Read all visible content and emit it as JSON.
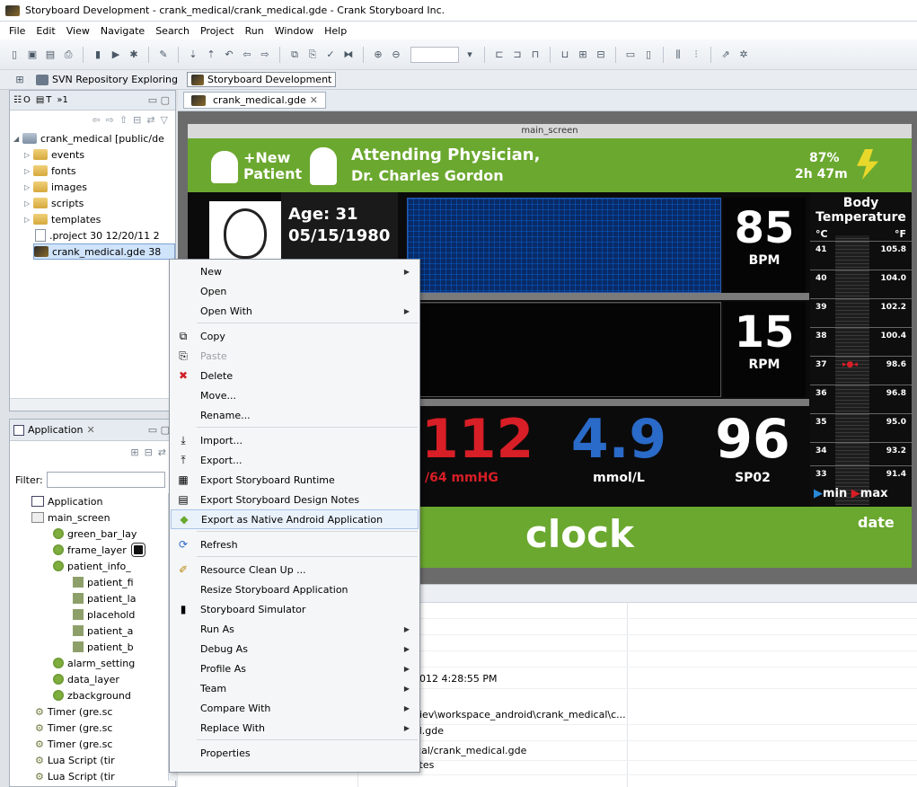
{
  "window": {
    "title": "Storyboard Development - crank_medical/crank_medical.gde - Crank Storyboard Inc."
  },
  "menubar": [
    "File",
    "Edit",
    "View",
    "Navigate",
    "Search",
    "Project",
    "Run",
    "Window",
    "Help"
  ],
  "perspectives": {
    "svn": "SVN Repository Exploring",
    "storyboard": "Storyboard Development"
  },
  "left_panel": {
    "tabs": [
      "O",
      "T",
      "»1"
    ],
    "tree": {
      "root": "crank_medical [public/de",
      "folders": [
        "events",
        "fonts",
        "images",
        "scripts",
        "templates"
      ],
      "project_file": ".project 30  12/20/11 2",
      "gde_file": "crank_medical.gde 38"
    }
  },
  "app_panel": {
    "tab": "Application",
    "filter_label": "Filter:",
    "items": [
      "Application",
      "main_screen",
      "green_bar_lay",
      "frame_layer",
      "patient_info_",
      "patient_fi",
      "patient_la",
      "placehold",
      "patient_a",
      "patient_b",
      "alarm_setting",
      "data_layer",
      "zbackground",
      "Timer (gre.sc",
      "Timer (gre.sc",
      "Timer (gre.sc",
      "Lua Script (tir",
      "Lua Script (tir"
    ]
  },
  "editor": {
    "tab": "crank_medical.gde",
    "screen_title": "main_screen",
    "new_patient_1": "+New",
    "new_patient_2": "Patient",
    "physician_1": "Attending Physician,",
    "physician_2": "Dr. Charles Gordon",
    "battery": "87%",
    "time_left": "2h 47m",
    "age": "Age: 31",
    "dob": "05/15/1980",
    "bpm_value": "85",
    "bpm_label": "BPM",
    "rpm_value": "15",
    "rpm_label": "RPM",
    "bp_value": "112",
    "bp_label": "/64 mmHG",
    "glucose_value": "4.9",
    "glucose_label": "mmol/L",
    "spo2_value": "96",
    "spo2_label": "SP02",
    "temp_title_1": "Body",
    "temp_title_2": "Temperature",
    "c_label": "°C",
    "f_label": "°F",
    "therm_rows": [
      [
        "41",
        "105.8"
      ],
      [
        "40",
        "104.0"
      ],
      [
        "39",
        "102.2"
      ],
      [
        "38",
        "100.4"
      ],
      [
        "37",
        "98.6"
      ],
      [
        "36",
        "96.8"
      ],
      [
        "35",
        "95.0"
      ],
      [
        "34",
        "93.2"
      ],
      [
        "33",
        "91.4"
      ]
    ],
    "min_label": "min",
    "max_label": "max",
    "clock": "clock",
    "date": "date"
  },
  "properties": {
    "values": [
      "2012 4:28:55 PM",
      "niev\\workspace_android\\crank_medical\\c...",
      "al.gde",
      "ical/crank_medical.gde",
      "ytes"
    ]
  },
  "context_menu": [
    {
      "label": "New",
      "sub": true,
      "icon": ""
    },
    {
      "label": "Open",
      "sub": false,
      "icon": ""
    },
    {
      "label": "Open With",
      "sub": true,
      "icon": ""
    },
    {
      "sep": true
    },
    {
      "label": "Copy",
      "sub": false,
      "icon": "copy"
    },
    {
      "label": "Paste",
      "sub": false,
      "icon": "paste",
      "disabled": true
    },
    {
      "label": "Delete",
      "sub": false,
      "icon": "delete"
    },
    {
      "label": "Move...",
      "sub": false,
      "icon": ""
    },
    {
      "label": "Rename...",
      "sub": false,
      "icon": ""
    },
    {
      "sep": true
    },
    {
      "label": "Import...",
      "sub": false,
      "icon": "import"
    },
    {
      "label": "Export...",
      "sub": false,
      "icon": "export"
    },
    {
      "label": "Export Storyboard Runtime",
      "sub": false,
      "icon": "runtime"
    },
    {
      "label": "Export Storyboard Design Notes",
      "sub": false,
      "icon": "notes"
    },
    {
      "label": "Export as Native Android Application",
      "sub": false,
      "icon": "android",
      "highlight": true
    },
    {
      "sep": true
    },
    {
      "label": "Refresh",
      "sub": false,
      "icon": "refresh"
    },
    {
      "sep": true
    },
    {
      "label": "Resource Clean Up ...",
      "sub": false,
      "icon": "clean"
    },
    {
      "label": "Resize Storyboard Application",
      "sub": false,
      "icon": ""
    },
    {
      "label": "Storyboard Simulator",
      "sub": false,
      "icon": "simulator"
    },
    {
      "label": "Run As",
      "sub": true,
      "icon": ""
    },
    {
      "label": "Debug As",
      "sub": true,
      "icon": ""
    },
    {
      "label": "Profile As",
      "sub": true,
      "icon": ""
    },
    {
      "label": "Team",
      "sub": true,
      "icon": ""
    },
    {
      "label": "Compare With",
      "sub": true,
      "icon": ""
    },
    {
      "label": "Replace With",
      "sub": true,
      "icon": ""
    },
    {
      "sep": true
    },
    {
      "label": "Properties",
      "sub": false,
      "icon": ""
    }
  ],
  "colors": {
    "green": "#6ba82f",
    "bp_red": "#d81e26",
    "glucose_blue": "#2a6ac8",
    "highlight": "#e9f1fb"
  }
}
